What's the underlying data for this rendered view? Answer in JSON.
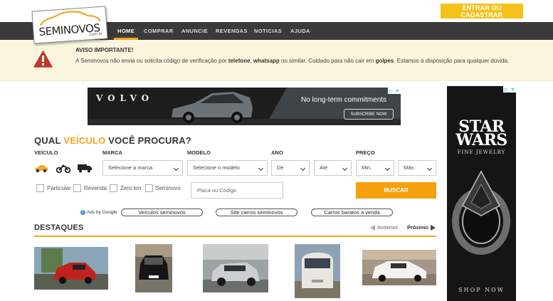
{
  "brand": {
    "name": "SEMINOVOS",
    "domain": ".com.br"
  },
  "header": {
    "login_button": "ENTRAR OU CADASTRAR"
  },
  "nav": [
    "HOME",
    "COMPRAR",
    "ANUNCIE",
    "REVENDAS",
    "NOTICIAS",
    "AJUDA"
  ],
  "alert": {
    "title": "AVISO IMPORTANTE!",
    "t1": "A Seminovos não envia ou solicita código de verificação por ",
    "b1": "telefone",
    "t2": ", ",
    "b2": "whatsapp",
    "t3": " ou similar. Cuidado para não cair em ",
    "b3": "golpes",
    "t4": ". Estamos à disposição para qualquer dúvida."
  },
  "ad_banner": {
    "brand": "VOLVO",
    "headline": "No long-term commitments",
    "cta": "SUBSCRIBE NOW"
  },
  "ad_side": {
    "logo_line1": "STAR",
    "logo_line2": "WARS",
    "subtitle": "FINE JEWELRY",
    "cta": "SHOP NOW"
  },
  "search": {
    "title_pre": "QUAL ",
    "title_hl": "VEÍCULO",
    "title_post": " VOCÊ PROCURA?",
    "labels": {
      "veiculo": "VEÍCULO",
      "marca": "MARCA",
      "modelo": "MODELO",
      "ano": "ANO",
      "preco": "PREÇO"
    },
    "selects": {
      "marca": "Selecione a marca",
      "modelo": "Selecione o modelo",
      "ano_de": "De",
      "ano_ate": "Até",
      "preco_min": "Min.",
      "preco_max": "Máx."
    },
    "checkboxes": [
      "Particular",
      "Revenda",
      "Zero km",
      "Seminovo"
    ],
    "placa_placeholder": "Placa ou Código",
    "button": "BUSCAR"
  },
  "ads_links": {
    "label": "Ads by Google",
    "links": [
      "Veículos seminovos",
      "Site carros seminovos",
      "Carros baratos a venda"
    ]
  },
  "destaques": {
    "title": "DESTAQUES",
    "prev": "Anterior",
    "next": "Próximo"
  },
  "colors": {
    "accent": "#f5a623",
    "nav_bg": "#3a3a3a",
    "alert_bg": "#fbf5de",
    "alert_icon": "#c0392b",
    "login_btn": "#f5c21b"
  }
}
